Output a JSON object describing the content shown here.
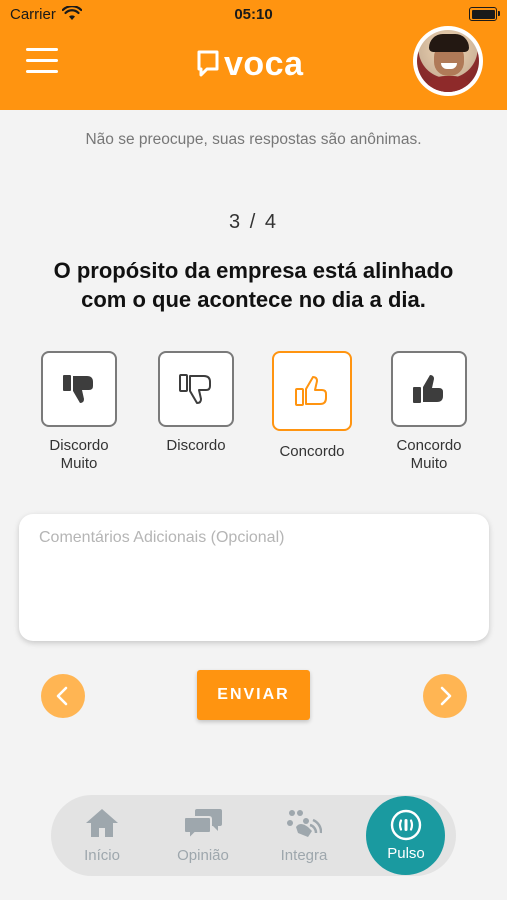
{
  "status_bar": {
    "carrier": "Carrier",
    "time": "05:10"
  },
  "header": {
    "logo_text": "voca",
    "menu_icon": "hamburger-icon"
  },
  "survey": {
    "subtitle": "Não se preocupe, suas respostas são anônimas.",
    "progress": "3 / 4",
    "question": "O propósito da empresa está alinhado com o que acontece no dia a dia.",
    "options": [
      {
        "line1": "Discordo",
        "line2": "Muito",
        "icon": "thumbs-down-filled-icon"
      },
      {
        "line1": "Discordo",
        "line2": "",
        "icon": "thumbs-down-outline-icon"
      },
      {
        "line1": "Concordo",
        "line2": "",
        "icon": "thumbs-up-outline-icon",
        "selected": true
      },
      {
        "line1": "Concordo",
        "line2": "Muito",
        "icon": "thumbs-up-filled-icon"
      }
    ],
    "comment_placeholder": "Comentários Adicionais (Opcional)",
    "send_label": "ENVIAR"
  },
  "tabbar": {
    "tabs": [
      {
        "label": "Início",
        "icon": "home-icon"
      },
      {
        "label": "Opinião",
        "icon": "chat-bubbles-icon"
      },
      {
        "label": "Integra",
        "icon": "integra-icon"
      },
      {
        "label": "Pulso",
        "icon": "pulse-icon",
        "active": true
      }
    ]
  },
  "colors": {
    "brand_orange": "#ff9410",
    "light_orange": "#ffb553",
    "teal": "#1a9aa0",
    "inactive_gray": "#9ea7ad"
  }
}
